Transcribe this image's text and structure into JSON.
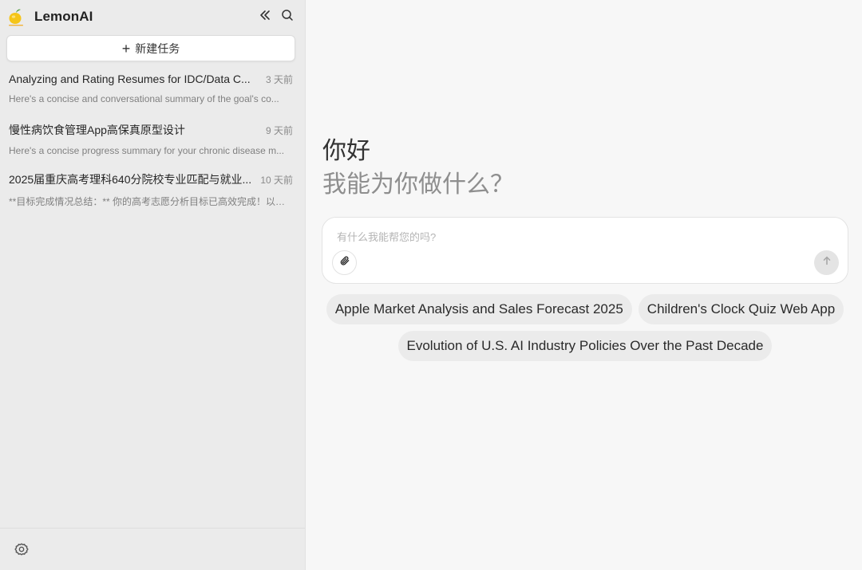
{
  "app": {
    "name": "LemonAI"
  },
  "sidebar": {
    "new_task_label": "新建任务",
    "tasks": [
      {
        "title": "Analyzing and Rating Resumes for IDC/Data C...",
        "time": "3 天前",
        "summary": "Here's a concise and conversational summary of the goal's co..."
      },
      {
        "title": "慢性病饮食管理App高保真原型设计",
        "time": "9 天前",
        "summary": "Here's a concise progress summary for your chronic disease m..."
      },
      {
        "title": "2025届重庆高考理科640分院校专业匹配与就业...",
        "time": "10 天前",
        "summary": "**目标完成情况总结：** 你的高考志愿分析目标已高效完成！以下..."
      }
    ]
  },
  "main": {
    "greeting": "你好",
    "question": "我能为你做什么？",
    "input_placeholder": "有什么我能帮您的吗?",
    "suggestions": [
      "Apple Market Analysis and Sales Forecast 2025",
      "Children's Clock Quiz Web App",
      "Evolution of U.S. AI Industry Policies Over the Past Decade"
    ]
  },
  "icons": {
    "collapse": "double-chevron-left-icon",
    "search": "search-icon",
    "attach": "paperclip-icon",
    "send": "arrow-up-icon",
    "settings": "gear-icon"
  },
  "colors": {
    "sidebar_bg": "#ebebeb",
    "main_bg": "#f7f7f7",
    "chip_bg": "#ebebeb",
    "logo_lemon": "#f5c518"
  }
}
